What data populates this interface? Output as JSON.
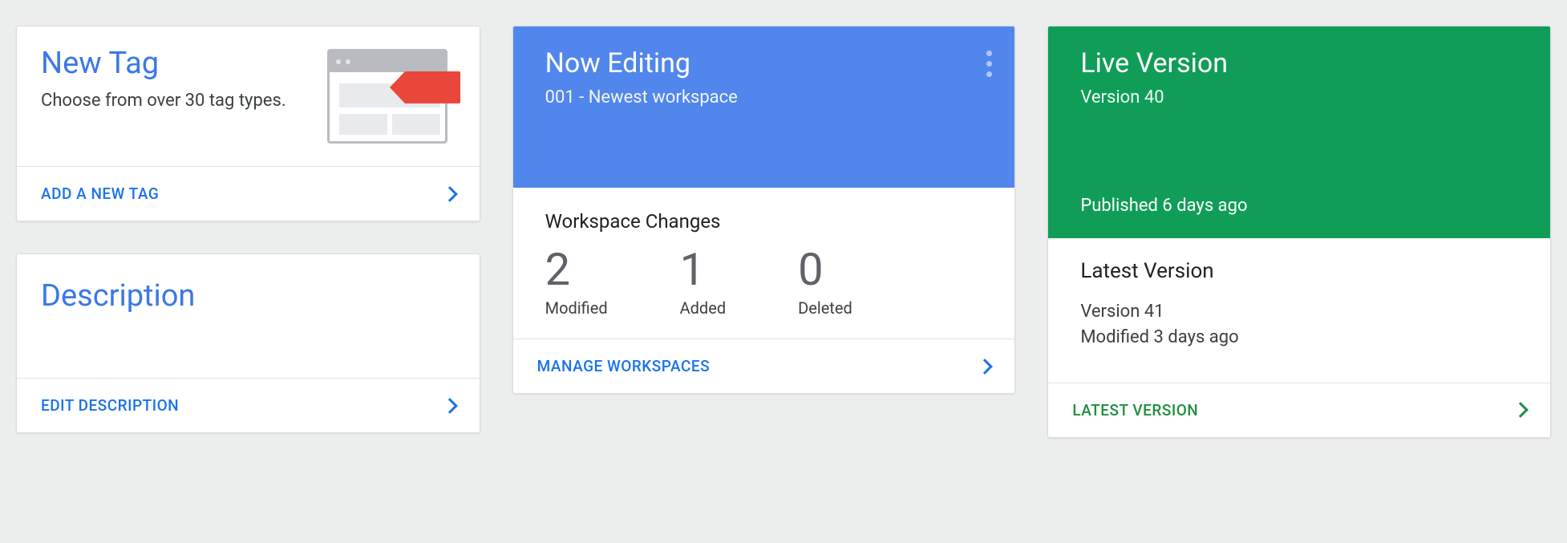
{
  "newTag": {
    "title": "New Tag",
    "subtitle": "Choose from over 30 tag types.",
    "action": "ADD A NEW TAG"
  },
  "description": {
    "title": "Description",
    "action": "EDIT DESCRIPTION"
  },
  "nowEditing": {
    "title": "Now Editing",
    "subtitle": "001 - Newest workspace",
    "changesTitle": "Workspace Changes",
    "stats": {
      "modified": {
        "count": "2",
        "label": "Modified"
      },
      "added": {
        "count": "1",
        "label": "Added"
      },
      "deleted": {
        "count": "0",
        "label": "Deleted"
      }
    },
    "action": "MANAGE WORKSPACES"
  },
  "liveVersion": {
    "title": "Live Version",
    "subtitle": "Version 40",
    "published": "Published 6 days ago",
    "latestTitle": "Latest Version",
    "latestVersion": "Version 41",
    "latestModified": "Modified 3 days ago",
    "action": "LATEST VERSION"
  }
}
